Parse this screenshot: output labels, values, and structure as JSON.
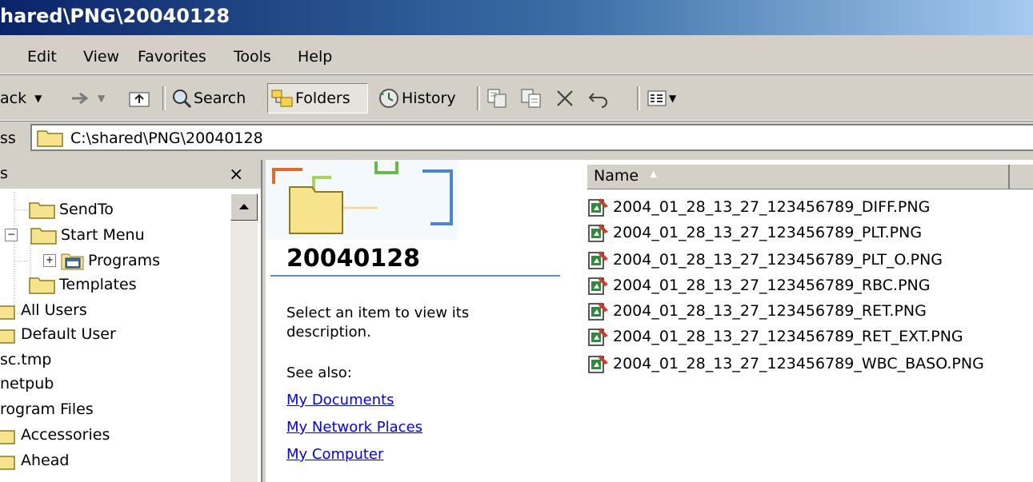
{
  "window": {
    "title": "hared\\PNG\\20040128"
  },
  "menu": {
    "items": [
      "Edit",
      "View",
      "Favorites",
      "Tools",
      "Help"
    ]
  },
  "toolbar": {
    "back_label": "ack",
    "search_label": "Search",
    "folders_label": "Folders",
    "history_label": "History",
    "icons": [
      "back-arrow-icon",
      "dropdown-arrow-icon",
      "forward-arrow-icon",
      "up-folder-icon",
      "search-icon",
      "folders-icon",
      "history-icon",
      "move-to-icon",
      "copy-to-icon",
      "delete-icon",
      "undo-icon",
      "views-icon"
    ]
  },
  "address": {
    "label": "ss",
    "value": "C:\\shared\\PNG\\20040128"
  },
  "folder_pane": {
    "header": "s",
    "close_label": "×",
    "items": [
      {
        "label": "SendTo"
      },
      {
        "label": "Start Menu"
      },
      {
        "label": "Programs"
      },
      {
        "label": "Templates"
      },
      {
        "label": "All Users"
      },
      {
        "label": "Default User"
      },
      {
        "label": "sc.tmp"
      },
      {
        "label": "netpub"
      },
      {
        "label": "rogram Files"
      },
      {
        "label": "Accessories"
      },
      {
        "label": "Ahead"
      }
    ]
  },
  "webview": {
    "folder_name": "20040128",
    "description": "Select an item to view its description.",
    "see_also": "See also:",
    "links": [
      "My Documents",
      "My Network Places",
      "My Computer"
    ]
  },
  "file_list": {
    "column_name": "Name",
    "files": [
      "2004_01_28_13_27_123456789_DIFF.PNG",
      "2004_01_28_13_27_123456789_PLT.PNG",
      "2004_01_28_13_27_123456789_PLT_O.PNG",
      "2004_01_28_13_27_123456789_RBC.PNG",
      "2004_01_28_13_27_123456789_RET.PNG",
      "2004_01_28_13_27_123456789_RET_EXT.PNG",
      "2004_01_28_13_27_123456789_WBC_BASO.PNG"
    ]
  },
  "colors": {
    "title_bar_start": "#0a246a",
    "title_bar_end": "#a6caf0",
    "window_bg": "#d4d0c8",
    "link": "#0000ff",
    "folder_yellow": "#f7e38b"
  }
}
